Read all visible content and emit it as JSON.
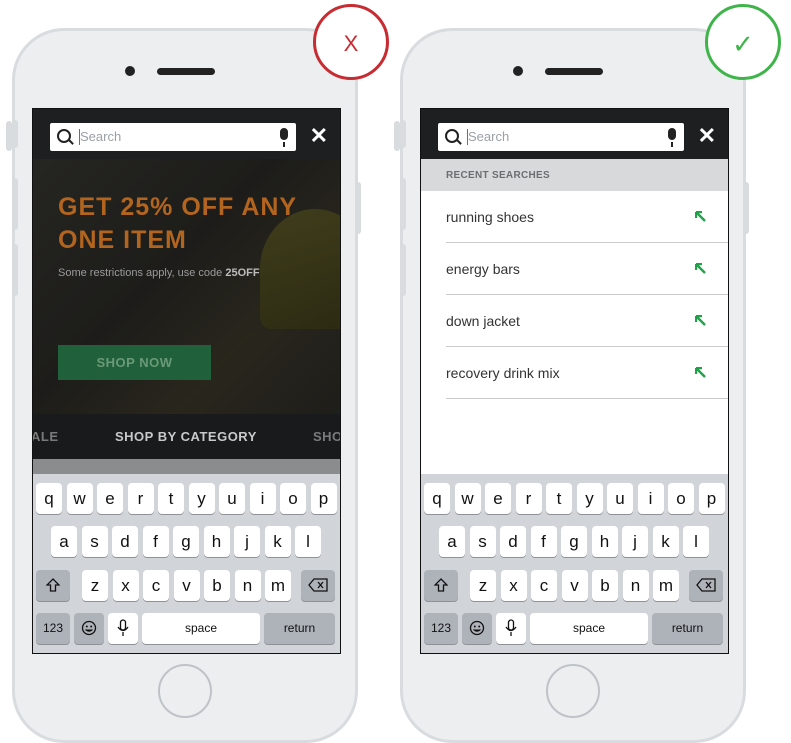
{
  "colors": {
    "bad": "#c62c32",
    "good": "#3fb44a",
    "promo": "#b3641f",
    "shop_button": "#20603a",
    "arrow": "#1fa24a"
  },
  "bad_example": {
    "mark": "X",
    "search_placeholder": "Search",
    "promo_line1": "GET 25% OFF ANY",
    "promo_line2": "ONE ITEM",
    "restrictions": "Some restrictions apply, use code ",
    "code": "25OFF",
    "shop_now": "SHOP NOW",
    "category_left": "ALE",
    "category_main": "SHOP BY CATEGORY",
    "category_right": "SHO"
  },
  "good_example": {
    "mark": "✓",
    "search_placeholder": "Search",
    "recent_header": "RECENT SEARCHES",
    "recent_items": [
      "running shoes",
      "energy bars",
      "down jacket",
      "recovery drink mix"
    ]
  },
  "keyboard": {
    "row1": [
      "q",
      "w",
      "e",
      "r",
      "t",
      "y",
      "u",
      "i",
      "o",
      "p"
    ],
    "row2": [
      "a",
      "s",
      "d",
      "f",
      "g",
      "h",
      "j",
      "k",
      "l"
    ],
    "row3": [
      "z",
      "x",
      "c",
      "v",
      "b",
      "n",
      "m"
    ],
    "numbers": "123",
    "space": "space",
    "return": "return",
    "shift_icon": "shift-icon",
    "delete_icon": "backspace-icon",
    "emoji_icon": "emoji-icon",
    "mic_icon": "microphone-icon"
  }
}
